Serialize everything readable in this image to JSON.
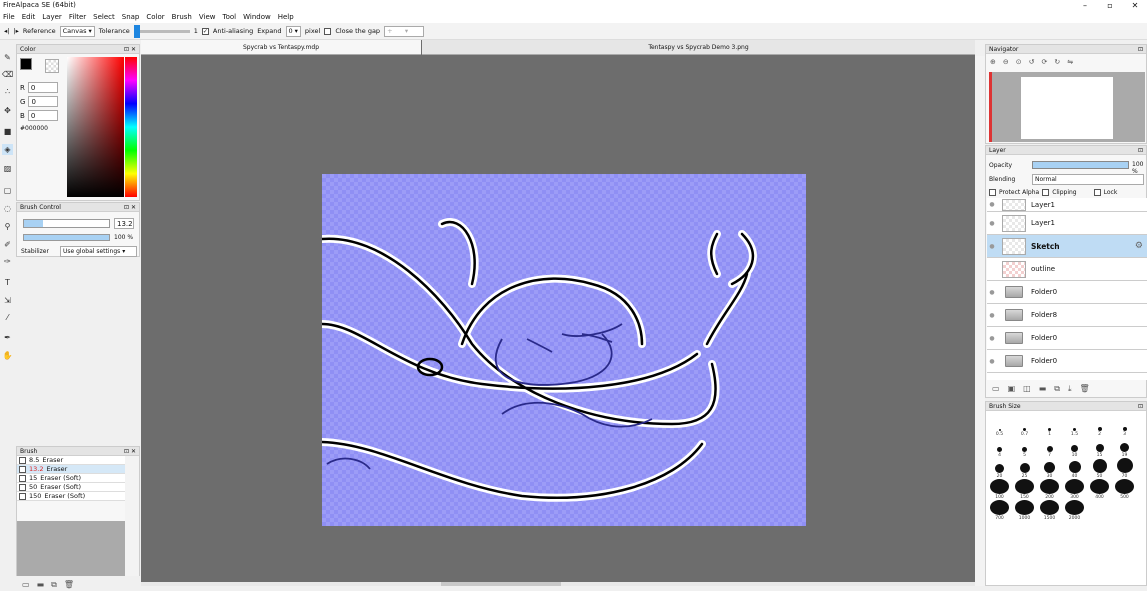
{
  "app": {
    "title": "FireAlpaca SE (64bit)"
  },
  "menu": [
    "File",
    "Edit",
    "Layer",
    "Filter",
    "Select",
    "Snap",
    "Color",
    "Brush",
    "View",
    "Tool",
    "Window",
    "Help"
  ],
  "options": {
    "reference_label": "Reference",
    "reference_value": "Canvas",
    "tolerance_label": "Tolerance",
    "tolerance_value": "1",
    "antialias_label": "Anti-aliasing",
    "expand_label": "Expand",
    "expand_value": "0",
    "pixel_label": "pixel",
    "close_gap_label": "Close the gap"
  },
  "color": {
    "title": "Color",
    "r_label": "R",
    "g_label": "G",
    "b_label": "B",
    "r": "0",
    "g": "0",
    "b": "0",
    "hex": "#000000"
  },
  "brush_control": {
    "title": "Brush Control",
    "size": "13.2",
    "opacity": "100 %",
    "opacity_value": 100,
    "stabilizer_label": "Stabilizer",
    "stabilizer_value": "Use global settings"
  },
  "brush": {
    "title": "Brush",
    "items": [
      {
        "size": "8.5",
        "name": "Eraser"
      },
      {
        "size": "13.2",
        "name": "Eraser",
        "selected": true
      },
      {
        "size": "15",
        "name": "Eraser (Soft)"
      },
      {
        "size": "50",
        "name": "Eraser (Soft)"
      },
      {
        "size": "150",
        "name": "Eraser (Soft)"
      }
    ]
  },
  "tabs": [
    "Spycrab vs Tentaspy.mdp",
    "Tentaspy vs Spycrab Demo 3.png"
  ],
  "navigator": {
    "title": "Navigator"
  },
  "layer": {
    "title": "Layer",
    "opacity_label": "Opacity",
    "opacity_value": "100 %",
    "blending_label": "Blending",
    "blending_value": "Normal",
    "protect_alpha": "Protect Alpha",
    "clipping": "Clipping",
    "lock": "Lock",
    "layers": [
      {
        "name": "Layer1",
        "kind": "layer"
      },
      {
        "name": "Layer1",
        "kind": "layer"
      },
      {
        "name": "Sketch",
        "kind": "layer",
        "selected": true
      },
      {
        "name": "outline",
        "kind": "layer"
      },
      {
        "name": "Folder0",
        "kind": "folder"
      },
      {
        "name": "Folder8",
        "kind": "folder"
      },
      {
        "name": "Folder0",
        "kind": "folder"
      },
      {
        "name": "Folder0",
        "kind": "folder"
      }
    ]
  },
  "brush_size": {
    "title": "Brush Size",
    "sizes": [
      "0.5",
      "0.7",
      "1",
      "1.5",
      "2",
      "3",
      "4",
      "5",
      "7",
      "10",
      "15",
      "19",
      "20",
      "25",
      "30",
      "40",
      "50",
      "70",
      "100",
      "150",
      "200",
      "300",
      "400",
      "500",
      "700",
      "1000",
      "1500",
      "2000"
    ]
  }
}
